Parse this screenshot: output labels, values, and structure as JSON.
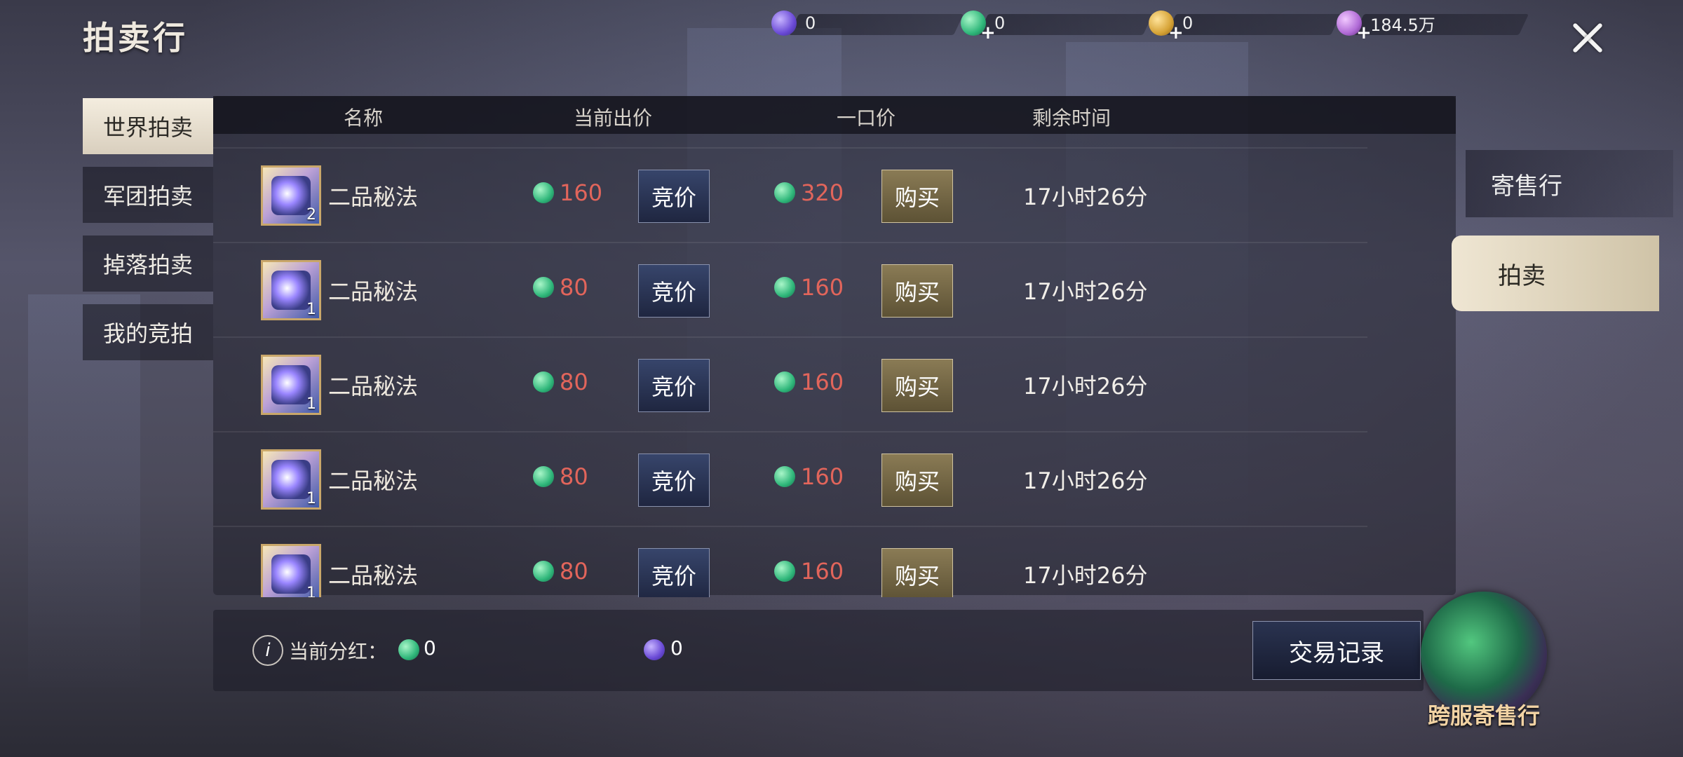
{
  "title": "拍卖行",
  "currencies": [
    {
      "icon": "purple-gem-icon",
      "value": "0",
      "has_plus": false
    },
    {
      "icon": "green-jade-icon",
      "value": "0",
      "has_plus": true
    },
    {
      "icon": "gold-coin-icon",
      "value": "0",
      "has_plus": true
    },
    {
      "icon": "violet-coin-icon",
      "value": "184.5万",
      "has_plus": true
    }
  ],
  "left_tabs": [
    "世界拍卖",
    "军团拍卖",
    "掉落拍卖",
    "我的竞拍"
  ],
  "columns": [
    "名称",
    "当前出价",
    "一口价",
    "剩余时间"
  ],
  "rows": [
    {
      "name": "二品秘法",
      "count": "2",
      "current_bid": "160",
      "bid_label": "竞价",
      "buyout": "320",
      "buy_label": "购买",
      "time": "17小时26分"
    },
    {
      "name": "二品秘法",
      "count": "1",
      "current_bid": "80",
      "bid_label": "竞价",
      "buyout": "160",
      "buy_label": "购买",
      "time": "17小时26分"
    },
    {
      "name": "二品秘法",
      "count": "1",
      "current_bid": "80",
      "bid_label": "竞价",
      "buyout": "160",
      "buy_label": "购买",
      "time": "17小时26分"
    },
    {
      "name": "二品秘法",
      "count": "1",
      "current_bid": "80",
      "bid_label": "竞价",
      "buyout": "160",
      "buy_label": "购买",
      "time": "17小时26分"
    },
    {
      "name": "二品秘法",
      "count": "1",
      "current_bid": "80",
      "bid_label": "竞价",
      "buyout": "160",
      "buy_label": "购买",
      "time": "17小时26分"
    }
  ],
  "footer": {
    "info_icon": "i",
    "dividend_label": "当前分红：",
    "green_value": "0",
    "purple_value": "0",
    "trade_record": "交易记录"
  },
  "side_tabs": {
    "consign": "寄售行",
    "auction": "拍卖"
  },
  "badge": {
    "label": "跨服寄售行"
  },
  "colors": {
    "price": "#e2655b",
    "active_tab": "#efe6d3"
  }
}
